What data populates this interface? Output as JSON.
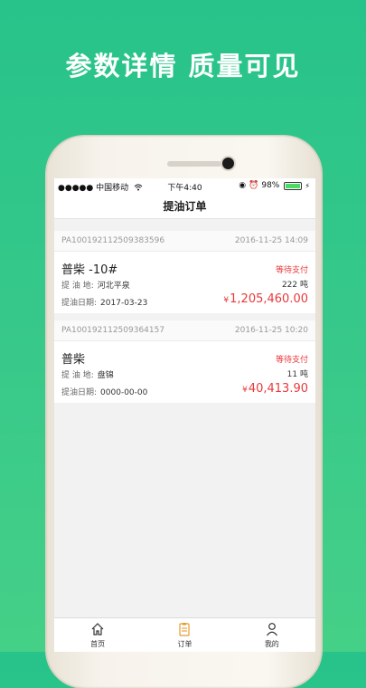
{
  "headline": "参数详情 质量可见",
  "statusbar": {
    "carrier": "●●●●● 中国移动",
    "wifi_icon": "wifi-icon",
    "time": "下午4:40",
    "battery_percent": "98%",
    "battery_level": 0.98
  },
  "navbar": {
    "title": "提油订单"
  },
  "orders": [
    {
      "order_no": "PA100192112509383596",
      "created": "2016-11-25 14:09",
      "product": "普柴 -10#",
      "status": "等待支付",
      "place_label": "提  油  地:",
      "place": "河北平泉",
      "quantity": "222 吨",
      "date_label": "提油日期:",
      "date": "2017-03-23",
      "currency": "¥",
      "amount": "1,205,460.00"
    },
    {
      "order_no": "PA100192112509364157",
      "created": "2016-11-25 10:20",
      "product": "普柴",
      "status": "等待支付",
      "place_label": "提  油  地:",
      "place": "盘锦",
      "quantity": "11 吨",
      "date_label": "提油日期:",
      "date": "0000-00-00",
      "currency": "¥",
      "amount": "40,413.90"
    }
  ],
  "tabs": [
    {
      "label": "首页",
      "icon": "home-icon"
    },
    {
      "label": "订单",
      "icon": "orders-icon"
    },
    {
      "label": "我的",
      "icon": "profile-icon"
    }
  ],
  "colors": {
    "accent_red": "#e8393b",
    "background_green": "#2ec58a"
  }
}
